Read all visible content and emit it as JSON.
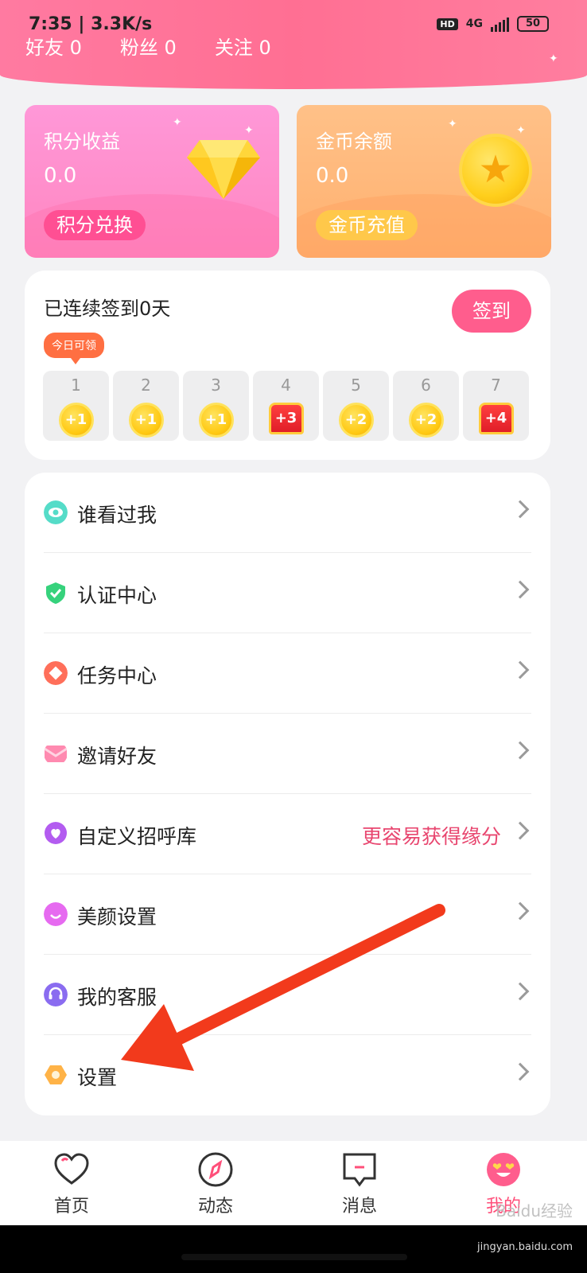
{
  "status": {
    "time": "7:35",
    "speed": "3.3K/s",
    "network": "4G",
    "battery": "50",
    "hd": "HD"
  },
  "profile": {
    "friends": "好友 0",
    "fans": "粉丝 0",
    "following": "关注 0"
  },
  "cards": {
    "points_title": "积分收益",
    "points_value": "0.0",
    "points_button": "积分兑换",
    "coins_title": "金币余额",
    "coins_value": "0.0",
    "coins_button": "金币充值"
  },
  "signin": {
    "title": "已连续签到0天",
    "button": "签到",
    "today_tag": "今日可领",
    "days": [
      {
        "day": "1",
        "reward": "+1",
        "type": "coin"
      },
      {
        "day": "2",
        "reward": "+1",
        "type": "coin"
      },
      {
        "day": "3",
        "reward": "+1",
        "type": "coin"
      },
      {
        "day": "4",
        "reward": "+3",
        "type": "chest"
      },
      {
        "day": "5",
        "reward": "+2",
        "type": "coin"
      },
      {
        "day": "6",
        "reward": "+2",
        "type": "coin"
      },
      {
        "day": "7",
        "reward": "+4",
        "type": "chest"
      }
    ]
  },
  "menu": [
    {
      "label": "谁看过我",
      "icon": "eye-icon",
      "color": "#4fd8c4"
    },
    {
      "label": "认证中心",
      "icon": "shield-check-icon",
      "color": "#34d07a"
    },
    {
      "label": "任务中心",
      "icon": "task-diamond-icon",
      "color": "#ff6f5a"
    },
    {
      "label": "邀请好友",
      "icon": "envelope-icon",
      "color": "#ff8ab0"
    },
    {
      "label": "自定义招呼库",
      "icon": "heart-chat-icon",
      "color": "#b35cf0",
      "hint": "更容易获得缘分"
    },
    {
      "label": "美颜设置",
      "icon": "smile-icon",
      "color": "#e66af0"
    },
    {
      "label": "我的客服",
      "icon": "headset-icon",
      "color": "#8a6cf0"
    },
    {
      "label": "设置",
      "icon": "gear-icon",
      "color": "#ffb347"
    }
  ],
  "tabs": [
    {
      "label": "首页",
      "icon": "heart-icon"
    },
    {
      "label": "动态",
      "icon": "compass-icon"
    },
    {
      "label": "消息",
      "icon": "message-icon"
    },
    {
      "label": "我的",
      "icon": "emoji-face-icon",
      "active": true
    }
  ],
  "watermark": {
    "brand": "Baidu经验",
    "url": "jingyan.baidu.com"
  },
  "colors": {
    "accent": "#ff5d8d",
    "header": "#ff7aa1",
    "arrow": "#f23a1c"
  }
}
